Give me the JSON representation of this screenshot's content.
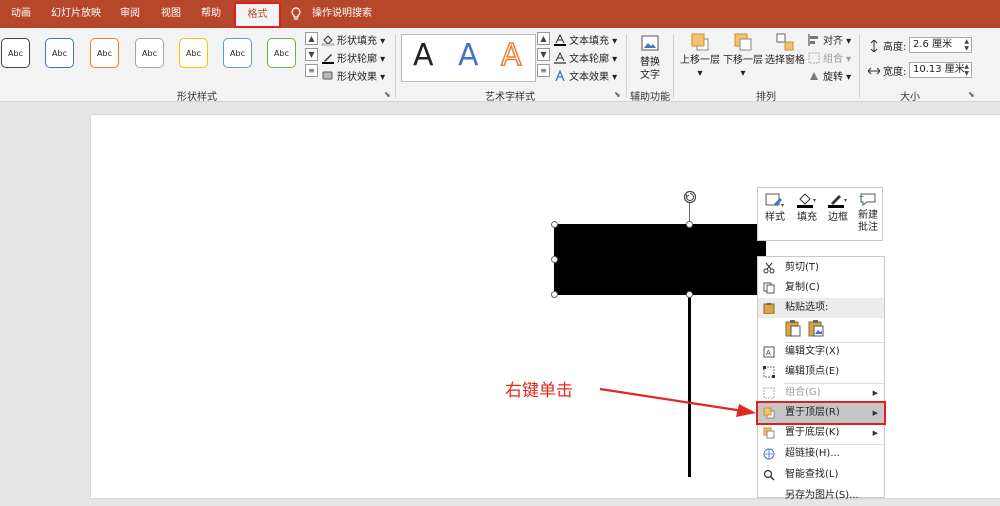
{
  "tabs": [
    {
      "label": "动画"
    },
    {
      "label": "幻灯片放映"
    },
    {
      "label": "审阅"
    },
    {
      "label": "视图"
    },
    {
      "label": "帮助"
    },
    {
      "label": "格式"
    }
  ],
  "tell_me": "操作说明搜索",
  "shape_styles": {
    "group_label": "形状样式",
    "thumb_label": "Abc",
    "thumb_colors": [
      "#444444",
      "#4472c4",
      "#ed7d31",
      "#a5a5a5",
      "#ffc000",
      "#5b9bd5",
      "#70ad47"
    ],
    "fill": "形状填充",
    "outline": "形状轮廓",
    "effects": "形状效果"
  },
  "wordart": {
    "group_label": "艺术字样式",
    "letters": [
      "A",
      "A",
      "A"
    ],
    "letter_colors": [
      "#000000",
      "#4472c4",
      "#ed7d31"
    ],
    "fill": "文本填充",
    "outline": "文本轮廓",
    "effects": "文本效果"
  },
  "accessibility": {
    "group_label": "辅助功能",
    "alt_text_line1": "替换",
    "alt_text_line2": "文字"
  },
  "arrange": {
    "group_label": "排列",
    "bring_forward_line1": "上移一层",
    "send_backward_line1": "下移一层",
    "selection_pane": "选择窗格",
    "align": "对齐",
    "group": "组合",
    "rotate": "旋转"
  },
  "size": {
    "group_label": "大小",
    "height_label": "高度:",
    "height_value": "2.6 厘米",
    "width_label": "宽度:",
    "width_value": "10.13 厘米"
  },
  "mini_toolbar": {
    "style": "样式",
    "fill": "填充",
    "outline": "边框",
    "new_comment_line1": "新建",
    "new_comment_line2": "批注"
  },
  "context_menu": {
    "cut": "剪切(T)",
    "copy": "复制(C)",
    "paste_options": "粘贴选项:",
    "edit_text": "编辑文字(X)",
    "edit_points": "编辑顶点(E)",
    "group": "组合(G)",
    "bring_to_front": "置于顶层(R)",
    "send_to_back": "置于底层(K)",
    "hyperlink": "超链接(H)...",
    "smart_lookup": "智能查找(L)",
    "save_as_picture": "另存为图片(S)..."
  },
  "annotation": "右键单击",
  "colors": {
    "ribbon_accent": "#b7472a",
    "highlight_red": "#e02020"
  }
}
